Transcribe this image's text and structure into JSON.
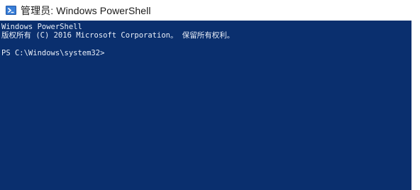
{
  "window": {
    "title": "管理员: Windows PowerShell",
    "app_icon": "powershell-icon"
  },
  "console": {
    "lines": [
      "Windows PowerShell",
      "版权所有 (C) 2016 Microsoft Corporation。 保留所有权利。",
      "",
      "PS C:\\Windows\\system32>"
    ]
  },
  "colors": {
    "console_background": "#0a2f6e",
    "console_text": "#e8eef8",
    "titlebar_background": "#ffffff"
  }
}
